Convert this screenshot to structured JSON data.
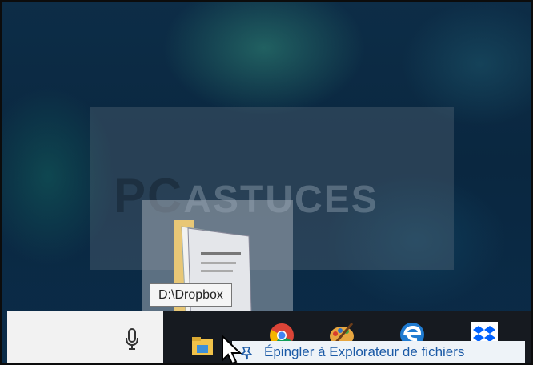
{
  "tooltip": {
    "path": "D:\\Dropbox"
  },
  "jump_list": {
    "pin_label": "Épingler à Explorateur de fichiers"
  },
  "watermark": {
    "logo_main": "PC",
    "logo_sub": "ASTUCES"
  },
  "colors": {
    "taskbar": "#161a20",
    "search_box": "#f2f2f2",
    "jump_item_bg": "#eef3f8",
    "jump_item_text": "#1b5aa6"
  },
  "icons": {
    "search_mic": "microphone-icon",
    "pin": "pin-icon",
    "taskbar": [
      "file-explorer-icon",
      "chrome-icon",
      "paint-app-icon",
      "edge-icon",
      "dropbox-icon"
    ]
  }
}
